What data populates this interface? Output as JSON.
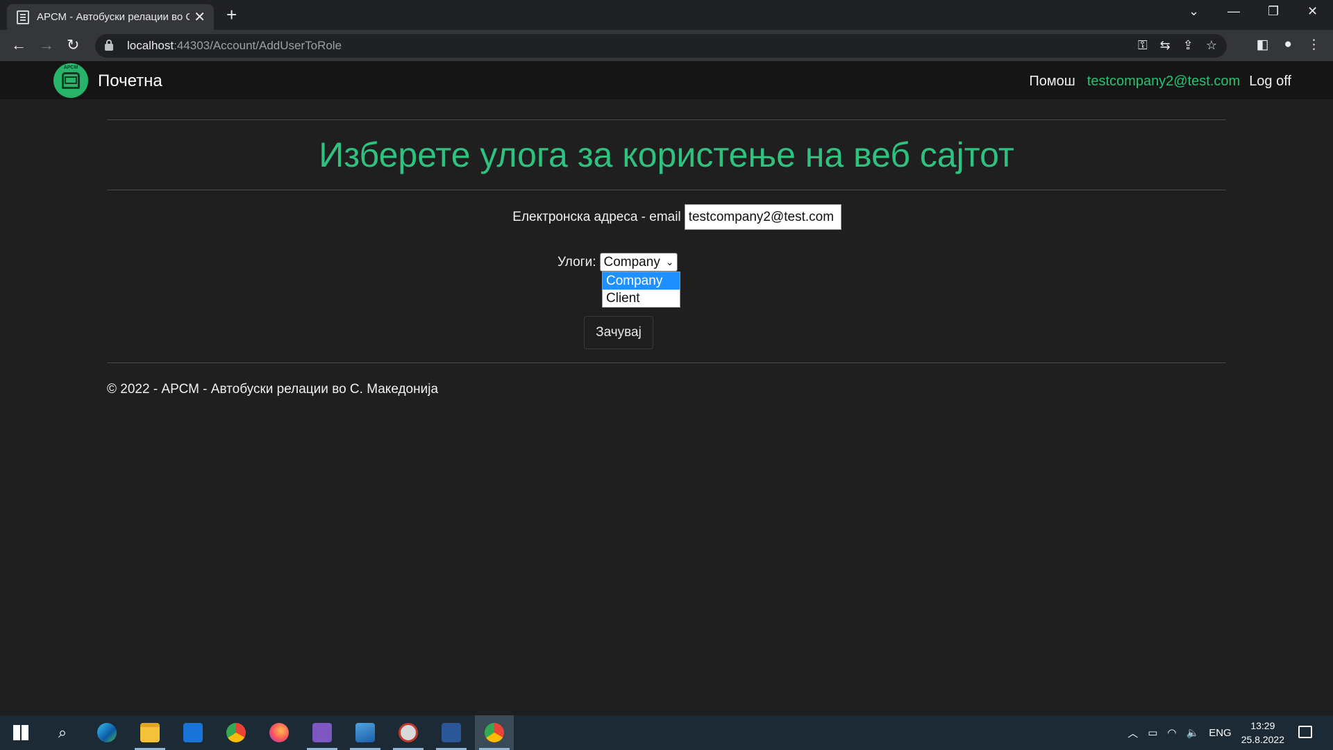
{
  "browser": {
    "tab_title": "АРСМ - Автобуски релации во С",
    "url_host": "localhost",
    "url_path": ":44303/Account/AddUserToRole"
  },
  "navbar": {
    "brand": "Почетна",
    "logo_text": "APCM",
    "help": "Помош",
    "user_email": "testcompany2@test.com",
    "logoff": "Log off"
  },
  "page": {
    "heading": "Изберете улога за користење на веб сајтот",
    "email_label": "Електронска адреса - email",
    "email_value": "testcompany2@test.com",
    "roles_label": "Улоги:",
    "roles_selected": "Company",
    "roles_options": [
      "Company",
      "Client"
    ],
    "save_label": "Зачувај"
  },
  "footer": {
    "text": "© 2022 - АРСМ - Автобуски релации во С. Македонија"
  },
  "taskbar": {
    "language": "ENG",
    "time": "13:29",
    "date": "25.8.2022"
  },
  "colors": {
    "accent_green": "#2ec27e",
    "background": "#1f1f1f",
    "select_highlight": "#1e90ff"
  }
}
